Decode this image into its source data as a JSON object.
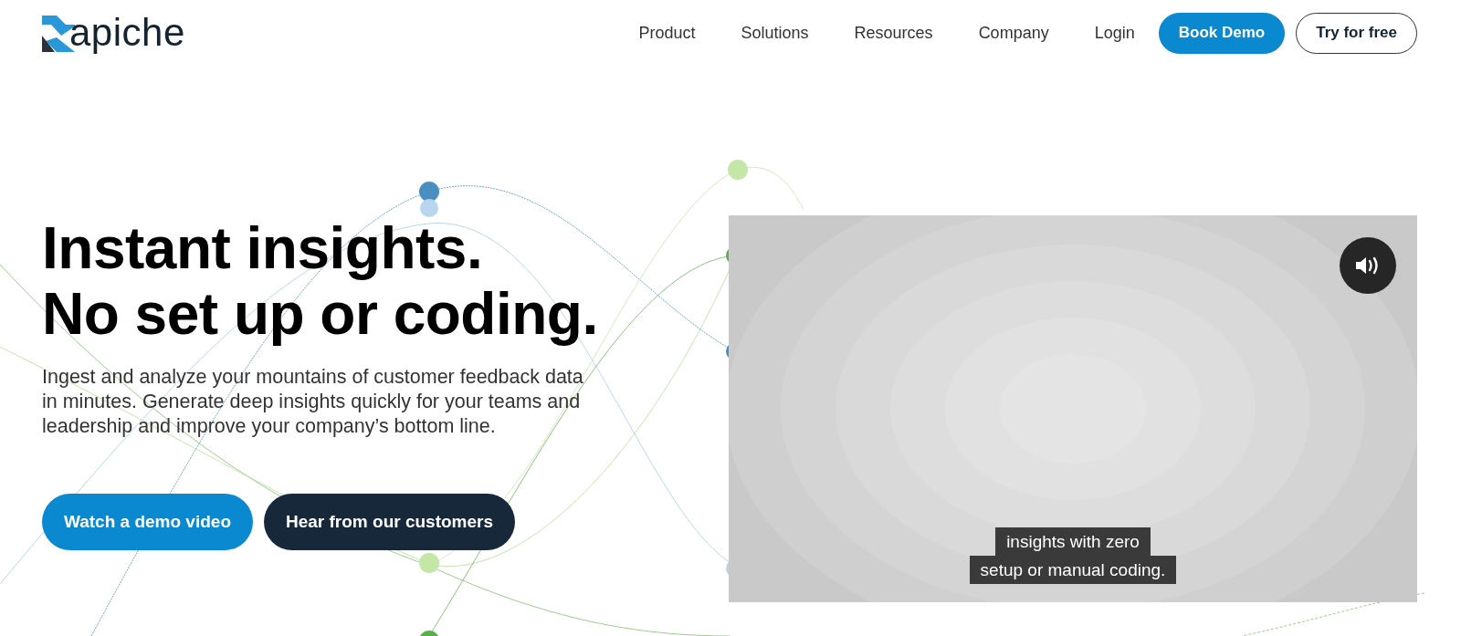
{
  "header": {
    "logo_text": "apiche",
    "nav": [
      {
        "label": "Product"
      },
      {
        "label": "Solutions"
      },
      {
        "label": "Resources"
      },
      {
        "label": "Company"
      },
      {
        "label": "Login"
      }
    ],
    "buttons": [
      {
        "label": "Book Demo",
        "kind": "primary"
      },
      {
        "label": "Try for free",
        "kind": "outline"
      }
    ]
  },
  "hero": {
    "title_lines": [
      "Instant insights.",
      "No set up or coding."
    ],
    "description": "Ingest and analyze your mountains of customer feedback data in minutes. Generate deep insights quickly for your teams and leadership and improve your company’s bottom line.",
    "buttons": [
      {
        "label": "Watch a demo video",
        "kind": "primary"
      },
      {
        "label": "Hear from our customers",
        "kind": "dark"
      }
    ]
  },
  "video": {
    "kind": "picture",
    "muted": false,
    "captions": [
      "insights with zero",
      "setup or manual coding."
    ]
  }
}
